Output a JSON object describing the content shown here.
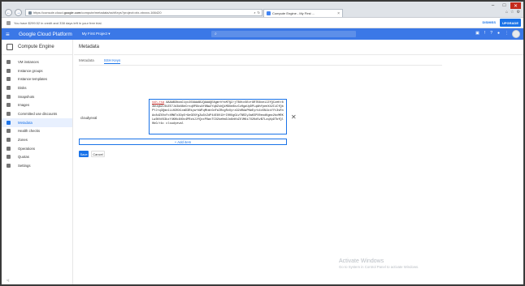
{
  "browser": {
    "url_prefix": "https://console.cloud.",
    "url_domain": "google.com",
    "url_rest": "/compute/metadata/sshKeys?project=xtx-xtxxxx-166420",
    "tab_title": "Compute Engine - My First ...",
    "window_controls": [
      "–",
      "□",
      "✕"
    ]
  },
  "trial_banner": {
    "text": "You have $299.52 in credit and 338 days left in your free trial.",
    "dismiss_label": "DISMISS",
    "upgrade_label": "UPGRADE"
  },
  "appbar": {
    "title": "Google Cloud Platform",
    "project": "My First Project ▾",
    "icons": [
      "cloud-shell-icon",
      "alert-icon",
      "help-icon",
      "notifications-icon",
      "more-icon"
    ]
  },
  "sidebar": {
    "header": "Compute Engine",
    "items": [
      {
        "label": "VM instances"
      },
      {
        "label": "Instance groups"
      },
      {
        "label": "Instance templates"
      },
      {
        "label": "Disks"
      },
      {
        "label": "Snapshots"
      },
      {
        "label": "Images"
      },
      {
        "label": "Committed use discounts"
      },
      {
        "label": "Metadata",
        "active": true
      },
      {
        "label": "Health checks"
      },
      {
        "label": "Zones"
      },
      {
        "label": "Operations"
      },
      {
        "label": "Quotas"
      },
      {
        "label": "Settings"
      }
    ],
    "collapse": "<|"
  },
  "main": {
    "title": "Metadata",
    "tabs": [
      "Metadata",
      "SSH Keys"
    ],
    "active_tab": "SSH Keys",
    "key_label": "cloudyeval",
    "key_value_prefix": "ssh-rsa",
    "key_value_rest": " AAAAB3NzaC1yc2EAAAABJQAAAQEAgmrhYsM7Q2/jTBOtc6Evr9R7B8xe1JZfQCzeKr83bUq6ZLSUZE7Jd3kN8eCrnq0P9ksAf6Nw2Yq8ZshQiM9Xe8kvCz0gaUpDPLqWhfpeeX42CiCfQbPYJrq3Qmx1LiH2KX1xmD3Rkyw+hWFqMtmtGnFaIRcgRvUyrz92dRAaPKmEyrb4x5N1ksYYt3vRnAc8dZXVcFcXMWTx3Op5+9eGEXfgZw3tZdP44E8V1X+I00UgG1vTNRZy2wK5PO0eodKgmc2bcMRKLw3KhVX3kzY4KHk4NOc4PRzbJJfQxxPOwvTCO2keHmDJo6nKhZOlM8i7U2Kd5vB7LzqXp9TbfQl0bG/rA= cloudyeval",
    "add_item_label": "+ Add item",
    "save_label": "Save",
    "cancel_label": "Cancel"
  },
  "watermark": {
    "line1": "Activate Windows",
    "line2": "Go to System in Control Panel to activate Windows."
  }
}
